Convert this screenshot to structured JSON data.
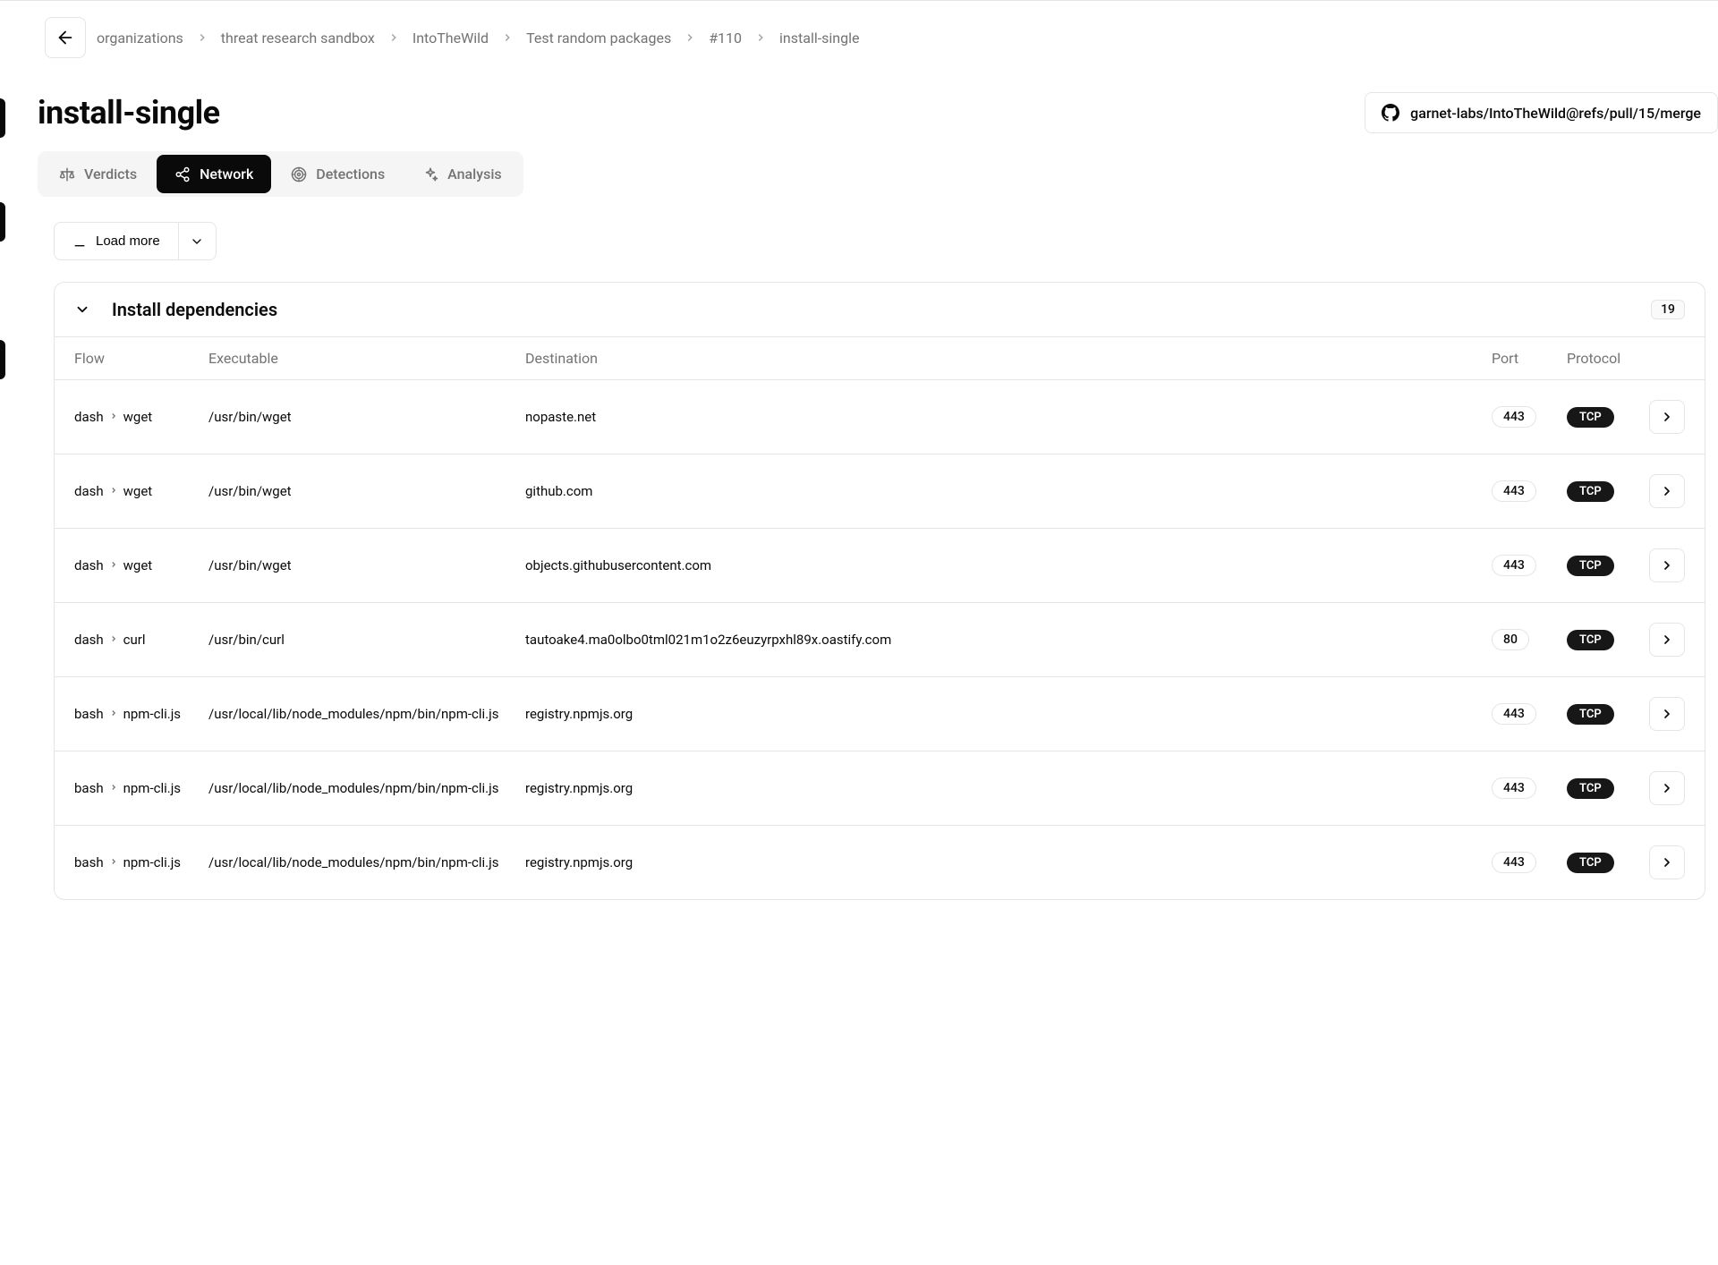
{
  "breadcrumbs": [
    "organizations",
    "threat research sandbox",
    "IntoTheWild",
    "Test random packages",
    "#110",
    "install-single"
  ],
  "page_title": "install-single",
  "repo": {
    "label": "garnet-labs/IntoTheWild@refs/pull/15/merge"
  },
  "tabs": [
    {
      "label": "Verdicts",
      "icon": "scales"
    },
    {
      "label": "Network",
      "icon": "share"
    },
    {
      "label": "Detections",
      "icon": "target"
    },
    {
      "label": "Analysis",
      "icon": "sparkles"
    }
  ],
  "active_tab": 1,
  "load_more_label": "Load more",
  "section": {
    "title": "Install dependencies",
    "count": "19",
    "columns": {
      "flow": "Flow",
      "executable": "Executable",
      "destination": "Destination",
      "port": "Port",
      "protocol": "Protocol"
    },
    "rows": [
      {
        "flow_from": "dash",
        "flow_to": "wget",
        "executable": "/usr/bin/wget",
        "destination": "nopaste.net",
        "port": "443",
        "protocol": "TCP"
      },
      {
        "flow_from": "dash",
        "flow_to": "wget",
        "executable": "/usr/bin/wget",
        "destination": "github.com",
        "port": "443",
        "protocol": "TCP"
      },
      {
        "flow_from": "dash",
        "flow_to": "wget",
        "executable": "/usr/bin/wget",
        "destination": "objects.githubusercontent.com",
        "port": "443",
        "protocol": "TCP"
      },
      {
        "flow_from": "dash",
        "flow_to": "curl",
        "executable": "/usr/bin/curl",
        "destination": "tautoake4.ma0olbo0tml021m1o2z6euzyrpxhl89x.oastify.com",
        "port": "80",
        "protocol": "TCP"
      },
      {
        "flow_from": "bash",
        "flow_to": "npm-cli.js",
        "executable": "/usr/local/lib/node_modules/npm/bin/npm-cli.js",
        "destination": "registry.npmjs.org",
        "port": "443",
        "protocol": "TCP"
      },
      {
        "flow_from": "bash",
        "flow_to": "npm-cli.js",
        "executable": "/usr/local/lib/node_modules/npm/bin/npm-cli.js",
        "destination": "registry.npmjs.org",
        "port": "443",
        "protocol": "TCP"
      },
      {
        "flow_from": "bash",
        "flow_to": "npm-cli.js",
        "executable": "/usr/local/lib/node_modules/npm/bin/npm-cli.js",
        "destination": "registry.npmjs.org",
        "port": "443",
        "protocol": "TCP"
      }
    ]
  }
}
